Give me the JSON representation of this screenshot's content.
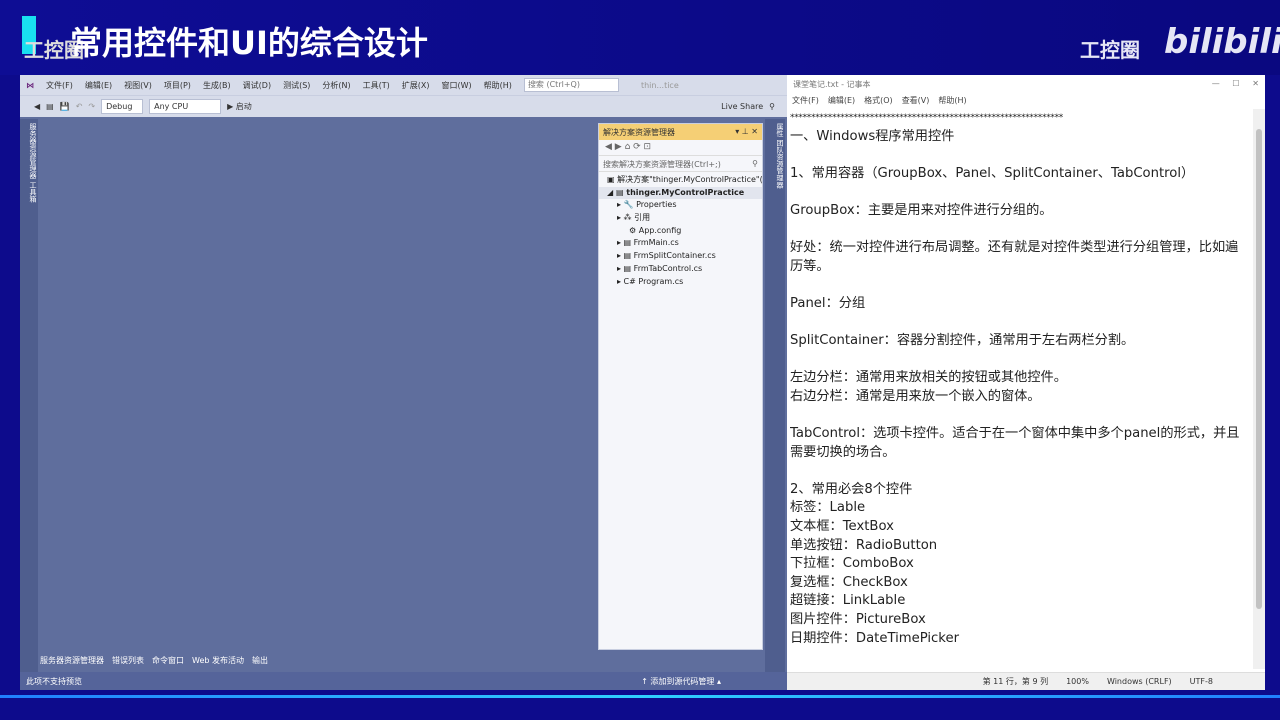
{
  "banner": {
    "title": "常用控件和UI的综合设计",
    "watermark": "工控圈",
    "bili": "bilibili"
  },
  "vs": {
    "menu": [
      "文件(F)",
      "编辑(E)",
      "视图(V)",
      "项目(P)",
      "生成(B)",
      "调试(D)",
      "测试(S)",
      "分析(N)",
      "工具(T)",
      "扩展(X)",
      "窗口(W)",
      "帮助(H)"
    ],
    "search_placeholder": "搜索 (Ctrl+Q)",
    "window_title": "thin...tice",
    "config": "Debug",
    "platform": "Any CPU",
    "start": "▶ 启动",
    "live_share": "Live Share",
    "left_strip": "服务器资源管理器 工具箱",
    "right_strip": "属性 团队资源管理器",
    "solution_explorer": {
      "title": "解决方案资源管理器",
      "search": "搜索解决方案资源管理器(Ctrl+;)",
      "items": [
        "解决方案\"thinger.MyControlPractice\"(",
        "thinger.MyControlPractice",
        "Properties",
        "引用",
        "App.config",
        "FrmMain.cs",
        "FrmSplitContainer.cs",
        "FrmTabControl.cs",
        "Program.cs"
      ]
    },
    "bottom_tabs": [
      "服务器资源管理器",
      "错误列表",
      "命令窗口",
      "Web 发布活动",
      "输出"
    ],
    "status_left": "此项不支持预览",
    "status_right": "↑ 添加到源代码管理 ▴"
  },
  "notepad": {
    "title": "课堂笔记.txt - 记事本",
    "menu": [
      "文件(F)",
      "编辑(E)",
      "格式(O)",
      "查看(V)",
      "帮助(H)"
    ],
    "lines": [
      "*****************************************************************",
      "一、Windows程序常用控件",
      "",
      "1、常用容器（GroupBox、Panel、SplitContainer、TabControl）",
      "",
      "GroupBox：主要是用来对控件进行分组的。",
      "",
      "好处：统一对控件进行布局调整。还有就是对控件类型进行分组管理，比如遍历等。",
      "",
      "Panel：分组",
      "",
      "SplitContainer：容器分割控件，通常用于左右两栏分割。",
      "",
      "左边分栏：通常用来放相关的按钮或其他控件。",
      "右边分栏：通常是用来放一个嵌入的窗体。",
      "",
      "TabControl：选项卡控件。适合于在一个窗体中集中多个panel的形式，并且需要切换的场合。",
      "",
      "2、常用必会8个控件",
      "标签：Lable",
      "文本框：TextBox",
      "单选按钮：RadioButton",
      "下拉框：ComboBox",
      "复选框：CheckBox",
      "超链接：LinkLable",
      "图片控件：PictureBox",
      "日期控件：DateTimePicker"
    ],
    "status": {
      "position": "第 11 行，第 9 列",
      "zoom": "100%",
      "eol": "Windows (CRLF)",
      "encoding": "UTF-8"
    }
  }
}
